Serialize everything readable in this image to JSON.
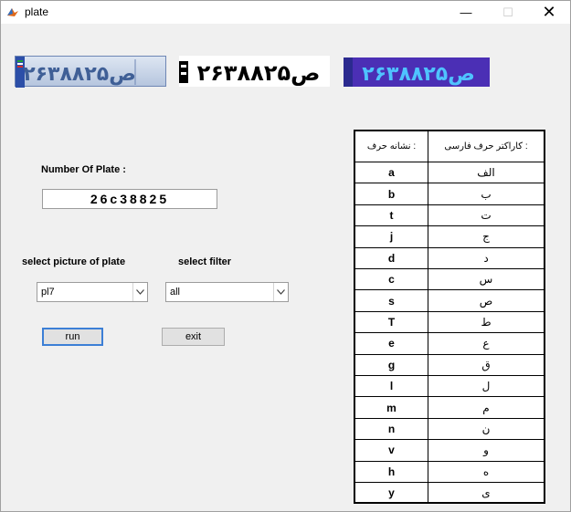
{
  "window": {
    "title": "plate",
    "minimize": "—",
    "maximize": "☐",
    "close": "✕"
  },
  "plates": {
    "number_digits": "۲۶ص۳۸۸۲۵"
  },
  "labels": {
    "number_of_plate": "Number Of  Plate :",
    "select_picture": "select picture of plate",
    "select_filter": "select filter"
  },
  "plate_number": "26c38825",
  "selects": {
    "picture_value": "pl7",
    "filter_value": "all"
  },
  "buttons": {
    "run": "run",
    "exit": "exit"
  },
  "table": {
    "header_latin": "نشانه حرف :",
    "header_persian": "کاراکتر حرف فارسی :",
    "rows": [
      {
        "latin": "a",
        "persian": "الف"
      },
      {
        "latin": "b",
        "persian": "ب"
      },
      {
        "latin": "t",
        "persian": "ت"
      },
      {
        "latin": "j",
        "persian": "ج"
      },
      {
        "latin": "d",
        "persian": "د"
      },
      {
        "latin": "c",
        "persian": "س"
      },
      {
        "latin": "s",
        "persian": "ص"
      },
      {
        "latin": "T",
        "persian": "ط"
      },
      {
        "latin": "e",
        "persian": "ع"
      },
      {
        "latin": "g",
        "persian": "ق"
      },
      {
        "latin": "l",
        "persian": "ل"
      },
      {
        "latin": "m",
        "persian": "م"
      },
      {
        "latin": "n",
        "persian": "ن"
      },
      {
        "latin": "v",
        "persian": "و"
      },
      {
        "latin": "h",
        "persian": "ه"
      },
      {
        "latin": "y",
        "persian": "ی"
      }
    ]
  },
  "colors": {
    "plate3_bg": "#4b2fb5",
    "plate3_text1": "#4fc3ff",
    "plate3_text2": "#ff6a3a",
    "accent": "#3c7fd6"
  }
}
